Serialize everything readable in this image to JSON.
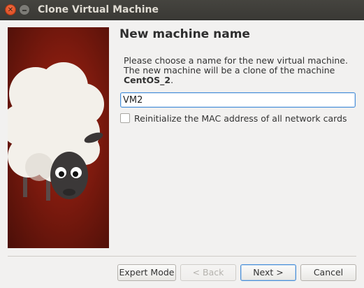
{
  "window": {
    "title": "Clone Virtual Machine"
  },
  "page": {
    "heading": "New machine name",
    "description_line1": "Please choose a name for the new virtual machine.",
    "description_line2": "The new machine will be a clone of the machine",
    "source_vm": "CentOS_2",
    "source_vm_suffix": "."
  },
  "name_field": {
    "value": "VM2"
  },
  "reinit_mac": {
    "label": "Reinitialize the MAC address of all network cards",
    "checked": false
  },
  "buttons": {
    "expert_mode": "Expert Mode",
    "back": "< Back",
    "next": "Next >",
    "cancel": "Cancel"
  },
  "colors": {
    "accent": "#4a90d9",
    "close_button": "#e9541f",
    "titlebar": "#3f3e3a",
    "side_panel": "#8b1d0f"
  },
  "icons": {
    "close": "close-icon",
    "minimize": "minimize-icon",
    "mascot": "sheep-illustration"
  }
}
